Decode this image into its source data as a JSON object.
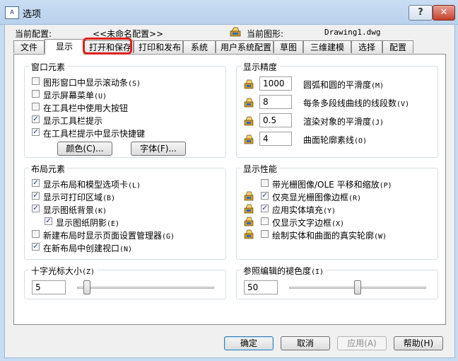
{
  "window": {
    "title": "选项",
    "app_icon_text": "A",
    "help_label": "?",
    "close_label": "✕"
  },
  "header": {
    "current_config_label": "当前配置:",
    "current_config_value": "<<未命名配置>>",
    "current_drawing_label": "当前图形:",
    "current_drawing_value": "Drawing1.dwg"
  },
  "tabs": [
    "文件",
    "显示",
    "打开和保存",
    "打印和发布",
    "系统",
    "用户系统配置",
    "草图",
    "三维建模",
    "选择",
    "配置"
  ],
  "active_tab": "显示",
  "highlighted_tab": "打开和保存",
  "window_elements": {
    "title": "窗口元素",
    "checkboxes": [
      {
        "label": "图形窗口中显示滚动条",
        "shortcut": "(S)",
        "checked": false
      },
      {
        "label": "显示屏幕菜单",
        "shortcut": "(U)",
        "checked": false
      },
      {
        "label": "在工具栏中使用大按钮",
        "shortcut": "",
        "checked": false
      },
      {
        "label": "显示工具栏提示",
        "shortcut": "",
        "checked": true
      },
      {
        "label": "在工具栏提示中显示快捷键",
        "shortcut": "",
        "checked": true
      }
    ],
    "colors_button": "颜色(C)...",
    "fonts_button": "字体(F)..."
  },
  "display_resolution": {
    "title": "显示精度",
    "items": [
      {
        "value": "1000",
        "label": "圆弧和圆的平滑度",
        "shortcut": "(M)"
      },
      {
        "value": "8",
        "label": "每条多段线曲线的线段数",
        "shortcut": "(V)"
      },
      {
        "value": "0.5",
        "label": "渲染对象的平滑度",
        "shortcut": "(J)"
      },
      {
        "value": "4",
        "label": "曲面轮廓素线",
        "shortcut": "(O)"
      }
    ]
  },
  "layout_elements": {
    "title": "布局元素",
    "checkboxes": [
      {
        "label": "显示布局和模型选项卡",
        "shortcut": "(L)",
        "checked": true
      },
      {
        "label": "显示可打印区域",
        "shortcut": "(B)",
        "checked": true
      },
      {
        "label": "显示图纸背景",
        "shortcut": "(K)",
        "checked": true
      },
      {
        "label": "显示图纸阴影",
        "shortcut": "(E)",
        "checked": true
      },
      {
        "label": "新建布局时显示页面设置管理器",
        "shortcut": "(G)",
        "checked": false
      },
      {
        "label": "在新布局中创建视口",
        "shortcut": "(N)",
        "checked": true
      }
    ]
  },
  "display_performance": {
    "title": "显示性能",
    "checkboxes": [
      {
        "label": "带光栅图像/OLE 平移和缩放",
        "shortcut": "(P)",
        "checked": false
      },
      {
        "label": "仅亮显光栅图像边框",
        "shortcut": "(R)",
        "checked": true
      },
      {
        "label": "应用实体填充",
        "shortcut": "(Y)",
        "checked": true
      },
      {
        "label": "仅显示文字边框",
        "shortcut": "(X)",
        "checked": false
      },
      {
        "label": "绘制实体和曲面的真实轮廓",
        "shortcut": "(W)",
        "checked": false
      }
    ]
  },
  "crosshair": {
    "title": "十字光标大小",
    "shortcut": "(Z)",
    "value": "5",
    "slider_fraction": 0.05
  },
  "xref_fade": {
    "title": "参照编辑的褪色度",
    "shortcut": "(I)",
    "value": "50",
    "slider_fraction": 0.5
  },
  "footer": {
    "ok": "确定",
    "cancel": "取消",
    "apply": "应用(A)",
    "help": "帮助(H)"
  },
  "colors": {
    "accent": "#e0201c",
    "checkmark": "#1a3d8c",
    "window_bg": "#c7dcf3"
  },
  "icons": {
    "drawing": "drawing-saved-icon",
    "pen": "saved-setting-pen-icon"
  }
}
